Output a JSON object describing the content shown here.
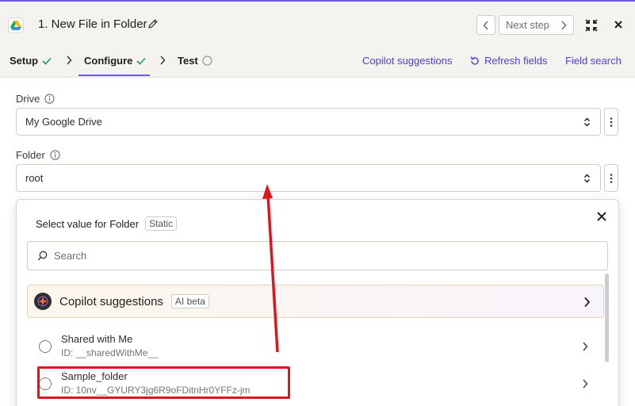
{
  "header": {
    "title": "1. New File in Folder",
    "next_step": "Next step",
    "app_icon": "google-drive-icon"
  },
  "tabs": {
    "setup": "Setup",
    "configure": "Configure",
    "test": "Test",
    "copilot_suggestions": "Copilot suggestions",
    "refresh_fields": "Refresh fields",
    "field_search": "Field search"
  },
  "fields": {
    "drive_label": "Drive",
    "drive_value": "My Google Drive",
    "folder_label": "Folder",
    "folder_value": "root"
  },
  "popup": {
    "title": "Select value for Folder",
    "badge": "Static",
    "search_placeholder": "Search",
    "copilot_label": "Copilot suggestions",
    "copilot_badge": "AI beta",
    "options": [
      {
        "name": "Shared with Me",
        "id": "ID: __sharedWithMe__"
      },
      {
        "name": "Sample_folder",
        "id": "ID: 10nv__GYURY3jg6R9oFDitnHr0YFFz-jm"
      }
    ]
  },
  "colors": {
    "accent": "#695be8",
    "link": "#4c3fd6",
    "check": "#1f9c5a",
    "annotation": "#e0141e"
  }
}
